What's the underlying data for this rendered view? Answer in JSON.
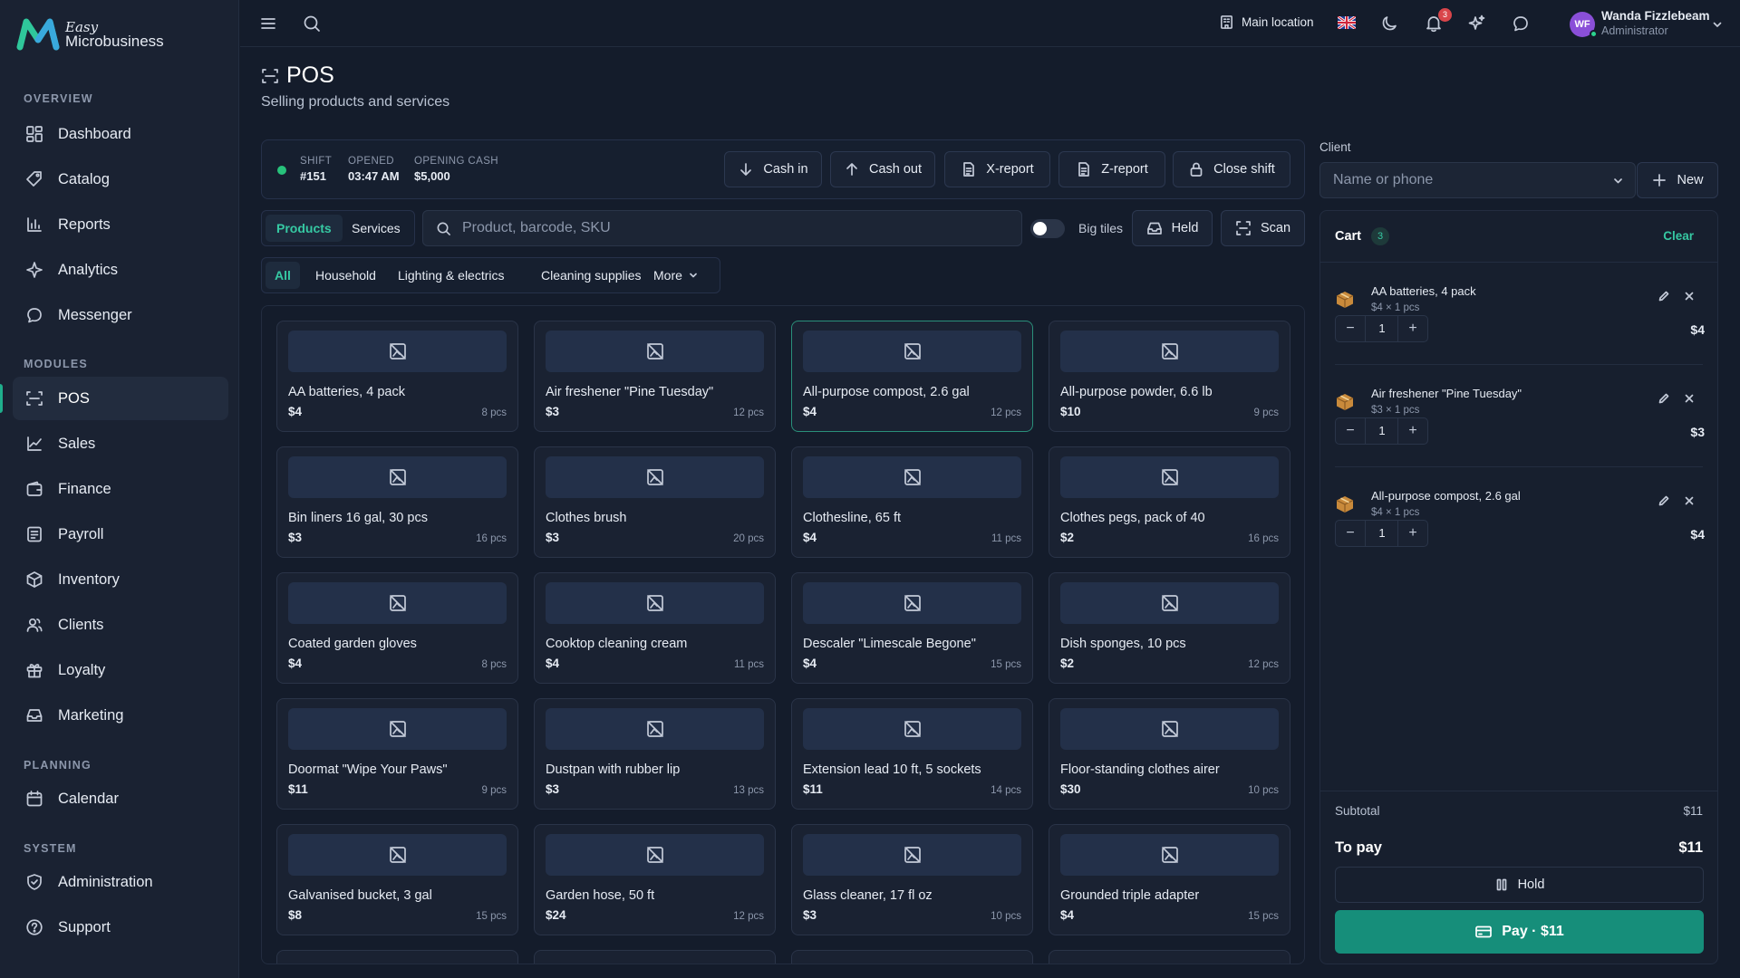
{
  "brand": {
    "easy": "Easy",
    "name": "Microbusiness",
    "accent": "#1fae8c"
  },
  "sidebar": {
    "sections": {
      "overview": "OVERVIEW",
      "modules": "MODULES",
      "planning": "PLANNING",
      "system": "SYSTEM"
    },
    "items": [
      {
        "label": "Dashboard",
        "icon": "dashboard-icon"
      },
      {
        "label": "Catalog",
        "icon": "tag-icon"
      },
      {
        "label": "Reports",
        "icon": "bar-chart-icon"
      },
      {
        "label": "Analytics",
        "icon": "sparkle-icon"
      },
      {
        "label": "Messenger",
        "icon": "chat-icon"
      },
      {
        "label": "POS",
        "icon": "scan-icon",
        "active": true
      },
      {
        "label": "Sales",
        "icon": "trend-icon"
      },
      {
        "label": "Finance",
        "icon": "wallet-icon"
      },
      {
        "label": "Payroll",
        "icon": "payroll-icon"
      },
      {
        "label": "Inventory",
        "icon": "box-icon"
      },
      {
        "label": "Clients",
        "icon": "users-icon"
      },
      {
        "label": "Loyalty",
        "icon": "gift-icon"
      },
      {
        "label": "Marketing",
        "icon": "inbox-icon"
      },
      {
        "label": "Calendar",
        "icon": "calendar-icon"
      },
      {
        "label": "Administration",
        "icon": "shield-icon"
      },
      {
        "label": "Support",
        "icon": "help-icon"
      }
    ]
  },
  "topbar": {
    "location": "Main location",
    "notifications": "3",
    "user": {
      "initials": "WF",
      "name": "Wanda Fizzlebeam",
      "role": "Administrator"
    }
  },
  "page": {
    "title": "POS",
    "subtitle": "Selling products and services"
  },
  "shift": {
    "shift_label": "SHIFT",
    "shift_value": "#151",
    "opened_label": "OPENED",
    "opened_value": "03:47 AM",
    "cash_label": "OPENING CASH",
    "cash_value": "$5,000",
    "buttons": {
      "cash_in": "Cash in",
      "cash_out": "Cash out",
      "x_report": "X-report",
      "z_report": "Z-report",
      "close": "Close shift"
    }
  },
  "tabs": {
    "products": "Products",
    "services": "Services"
  },
  "search": {
    "placeholder": "Product, barcode, SKU",
    "value": ""
  },
  "controls": {
    "big_tiles": "Big tiles",
    "held": "Held",
    "scan": "Scan"
  },
  "categories": {
    "all": "All",
    "household": "Household",
    "lighting": "Lighting & electrics",
    "cleaning": "Cleaning supplies",
    "more": "More"
  },
  "products": [
    {
      "name": "AA batteries, 4 pack",
      "price": "$4",
      "stock": "8 pcs"
    },
    {
      "name": "Air freshener \"Pine Tuesday\"",
      "price": "$3",
      "stock": "12 pcs"
    },
    {
      "name": "All-purpose compost, 2.6 gal",
      "price": "$4",
      "stock": "12 pcs",
      "selected": true
    },
    {
      "name": "All-purpose powder, 6.6 lb",
      "price": "$10",
      "stock": "9 pcs"
    },
    {
      "name": "Bin liners 16 gal, 30 pcs",
      "price": "$3",
      "stock": "16 pcs"
    },
    {
      "name": "Clothes brush",
      "price": "$3",
      "stock": "20 pcs"
    },
    {
      "name": "Clothesline, 65 ft",
      "price": "$4",
      "stock": "11 pcs"
    },
    {
      "name": "Clothes pegs, pack of 40",
      "price": "$2",
      "stock": "16 pcs"
    },
    {
      "name": "Coated garden gloves",
      "price": "$4",
      "stock": "8 pcs"
    },
    {
      "name": "Cooktop cleaning cream",
      "price": "$4",
      "stock": "11 pcs"
    },
    {
      "name": "Descaler \"Limescale Begone\"",
      "price": "$4",
      "stock": "15 pcs"
    },
    {
      "name": "Dish sponges, 10 pcs",
      "price": "$2",
      "stock": "12 pcs"
    },
    {
      "name": "Doormat \"Wipe Your Paws\"",
      "price": "$11",
      "stock": "9 pcs"
    },
    {
      "name": "Dustpan with rubber lip",
      "price": "$3",
      "stock": "13 pcs"
    },
    {
      "name": "Extension lead 10 ft, 5 sockets",
      "price": "$11",
      "stock": "14 pcs"
    },
    {
      "name": "Floor-standing clothes airer",
      "price": "$30",
      "stock": "10 pcs"
    },
    {
      "name": "Galvanised bucket, 3 gal",
      "price": "$8",
      "stock": "15 pcs"
    },
    {
      "name": "Garden hose, 50 ft",
      "price": "$24",
      "stock": "12 pcs"
    },
    {
      "name": "Glass cleaner, 17 fl oz",
      "price": "$3",
      "stock": "10 pcs"
    },
    {
      "name": "Grounded triple adapter",
      "price": "$4",
      "stock": "15 pcs"
    }
  ],
  "client": {
    "label": "Client",
    "placeholder": "Name or phone",
    "new_label": "New"
  },
  "cart": {
    "title": "Cart",
    "count": "3",
    "clear": "Clear",
    "items": [
      {
        "name": "AA batteries, 4 pack",
        "unit": "$4 × 1 pcs",
        "qty": "1",
        "total": "$4"
      },
      {
        "name": "Air freshener \"Pine Tuesday\"",
        "unit": "$3 × 1 pcs",
        "qty": "1",
        "total": "$3"
      },
      {
        "name": "All-purpose compost, 2.6 gal",
        "unit": "$4 × 1 pcs",
        "qty": "1",
        "total": "$4"
      }
    ],
    "subtotal_label": "Subtotal",
    "subtotal": "$11",
    "topay_label": "To pay",
    "topay": "$11",
    "hold": "Hold",
    "pay": "Pay · $11"
  }
}
